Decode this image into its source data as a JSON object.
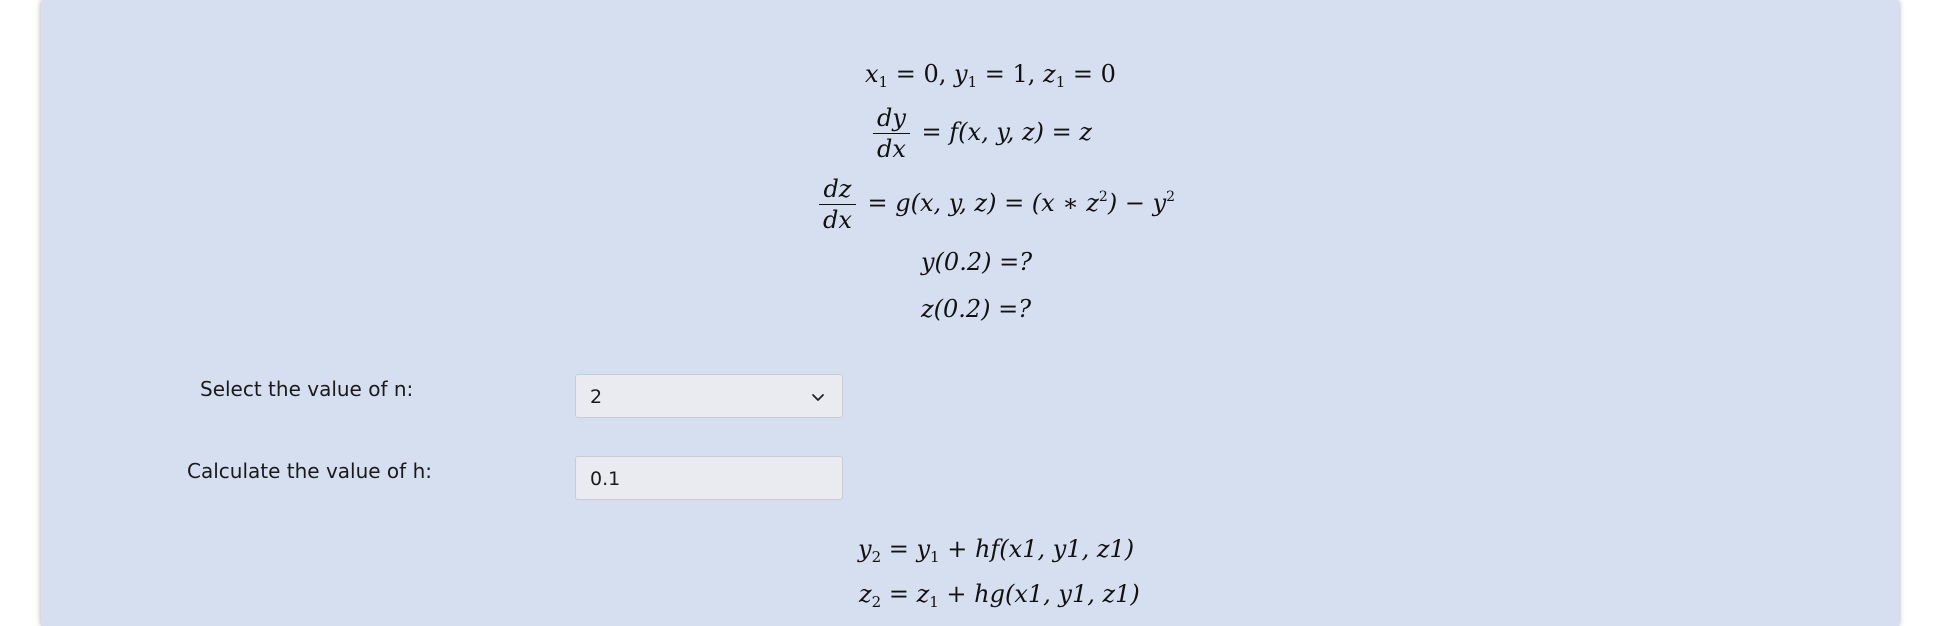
{
  "equations": {
    "initial": {
      "x1_val": "0",
      "y1_val": "1",
      "z1_val": "0"
    },
    "dydx": {
      "num": "dy",
      "den": "dx",
      "rhs": "f(x, y, z) = z"
    },
    "dzdx": {
      "num": "dz",
      "den": "dx",
      "rhs_a": "g(x, y, z) = (x ∗ z",
      "rhs_b": ") − y",
      "exp": "2"
    },
    "y_query": "y(0.2) =?",
    "z_query": "z(0.2) =?"
  },
  "form": {
    "n_label": "Select the value of n:",
    "n_value": "2",
    "h_label": "Calculate the value of h:",
    "h_value": "0.1"
  },
  "formulas": {
    "y2_rhs": "hf(x1, y1, z1)",
    "z2_rhs": "hg(x1, y1, z1)"
  },
  "icons": {
    "select_chevron": "chevron-down-icon"
  },
  "colors": {
    "panel_bg": "#d6dff0",
    "field_bg": "#e9ebf0"
  }
}
